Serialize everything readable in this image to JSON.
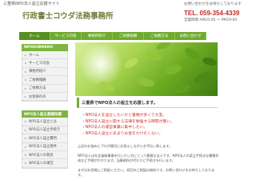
{
  "header": {
    "tagline": "三重県NPO法人設立応援サイト",
    "logo": "行政書士コウダ法務事務所",
    "contact_note": "お問い合わせをお待ちしております",
    "tel": "TEL. 059-354-4339",
    "hours": "営業時間 AM10:00 ～ PM19:00"
  },
  "nav": [
    "ホーム",
    "サービス内容",
    "事務所紹介",
    "ご依頼報酬",
    "ご依頼方法",
    "お問い合わせ"
  ],
  "sidebar": {
    "menu_heading": "NPOSUBMENU",
    "menu": [
      "ホーム",
      "サービス内容",
      "事務所紹介",
      "ご依頼報酬",
      "ご依頼方法",
      "お客様の声"
    ],
    "npo_heading": "NPO法人設立基礎知識",
    "npo": [
      "NPO法人設立とは",
      "NPO法人設立手続き",
      "NPO法人設立費用",
      "NPO法人設立要件",
      "NPO法人の税金",
      "NPO法人の運営"
    ]
  },
  "main": {
    "heading": "三重県でNPO法人の設立を応援します。",
    "points": [
      "・NPO法人を設立したいけど書類が多くて大変。",
      "・NPO法人設立に関する法律を勉強する時間が無い。",
      "・NPO法人の運営事業に集中したい。",
      "・NPO法人設立にあまりお金をかけたくない。"
    ],
    "paragraphs": [
      "上記のお悩みにプロが親切にお答えしながらお手伝い致します。",
      "NPO法人は社会貢献事業を行いたい方にとって最適な法人です。NPO法人の設立手続きは書類作成など手間がかかります。当事務所が代わりに手続きを行います。",
      "まずはお気軽にご相談ください。初回のご相談は無料です。お問い合わせをお待ちしております。"
    ]
  }
}
